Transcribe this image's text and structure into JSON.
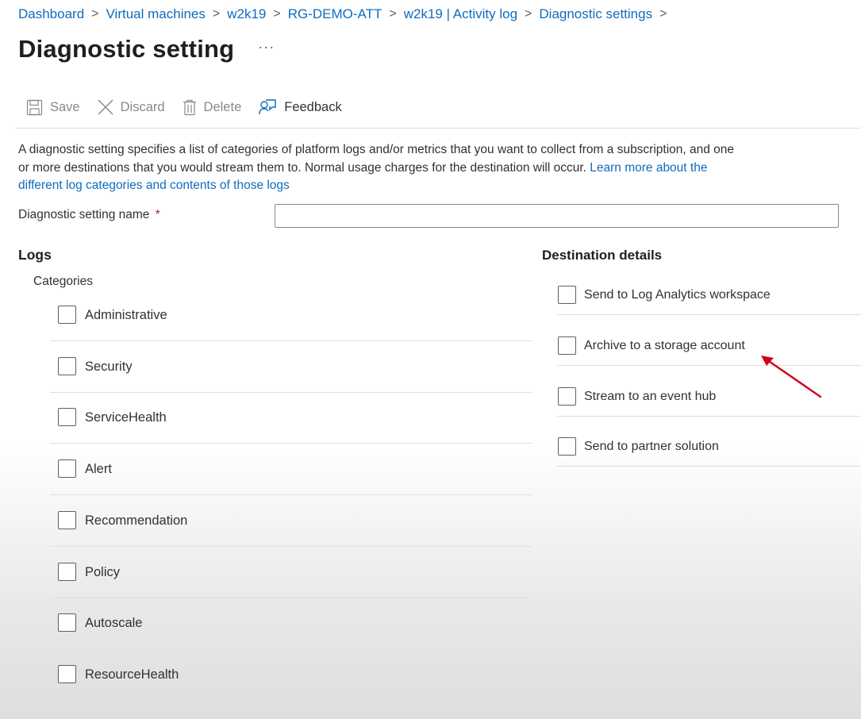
{
  "breadcrumb": [
    {
      "label": "Dashboard"
    },
    {
      "label": "Virtual machines"
    },
    {
      "label": "w2k19"
    },
    {
      "label": "RG-DEMO-ATT"
    },
    {
      "label": "w2k19 | Activity log"
    },
    {
      "label": "Diagnostic settings"
    }
  ],
  "page": {
    "title": "Diagnostic setting",
    "more": "···"
  },
  "toolbar": {
    "save": "Save",
    "discard": "Discard",
    "delete": "Delete",
    "feedback": "Feedback"
  },
  "description": {
    "text": "A diagnostic setting specifies a list of categories of platform logs and/or metrics that you want to collect from a subscription, and one or more destinations that you would stream them to. Normal usage charges for the destination will occur.",
    "link": "Learn more about the different log categories and contents of those logs"
  },
  "name_field": {
    "label": "Diagnostic setting name",
    "required_mark": "*",
    "value": "",
    "placeholder": ""
  },
  "logs": {
    "heading": "Logs",
    "categories_label": "Categories",
    "categories": [
      {
        "label": "Administrative",
        "checked": false
      },
      {
        "label": "Security",
        "checked": false
      },
      {
        "label": "ServiceHealth",
        "checked": false
      },
      {
        "label": "Alert",
        "checked": false
      },
      {
        "label": "Recommendation",
        "checked": false
      },
      {
        "label": "Policy",
        "checked": false
      },
      {
        "label": "Autoscale",
        "checked": false
      },
      {
        "label": "ResourceHealth",
        "checked": false
      }
    ]
  },
  "destination": {
    "heading": "Destination details",
    "options": [
      {
        "label": "Send to Log Analytics workspace",
        "checked": false
      },
      {
        "label": "Archive to a storage account",
        "checked": false
      },
      {
        "label": "Stream to an event hub",
        "checked": false
      },
      {
        "label": "Send to partner solution",
        "checked": false
      }
    ]
  },
  "annotation": {
    "arrow_color": "#d0021b"
  },
  "colors": {
    "link": "#0f6cbd",
    "required": "#a4262c"
  }
}
